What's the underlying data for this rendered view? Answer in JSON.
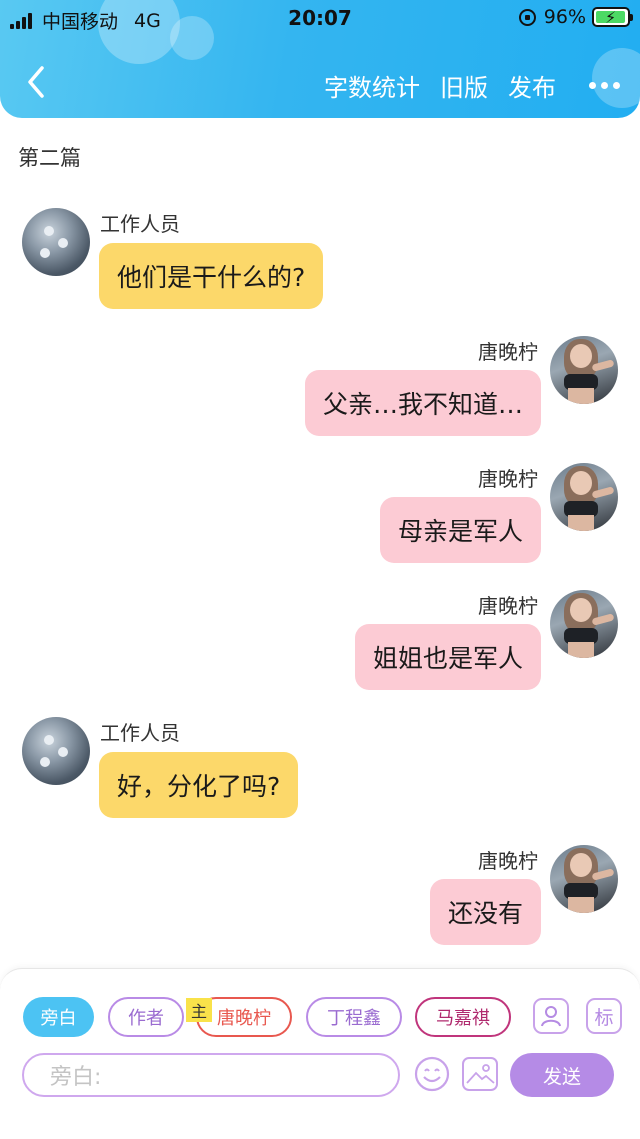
{
  "status_bar": {
    "carrier": "中国移动",
    "network": "4G",
    "time": "20:07",
    "battery": "96%",
    "battery_level": 0.96
  },
  "header": {
    "actions": [
      "字数统计",
      "旧版",
      "发布"
    ]
  },
  "section_title": "第二篇",
  "messages": [
    {
      "side": "left",
      "name": "工作人员",
      "text": "他们是干什么的?",
      "color": "#fcd86a"
    },
    {
      "side": "right",
      "name": "唐晚柠",
      "text": "父亲…我不知道…",
      "color": "#fccbd4"
    },
    {
      "side": "right",
      "name": "唐晚柠",
      "text": "母亲是军人",
      "color": "#fccbd4"
    },
    {
      "side": "right",
      "name": "唐晚柠",
      "text": "姐姐也是军人",
      "color": "#fccbd4"
    },
    {
      "side": "left",
      "name": "工作人员",
      "text": "好，分化了吗?",
      "color": "#fcd86a"
    },
    {
      "side": "right",
      "name": "唐晚柠",
      "text": "还没有",
      "color": "#fccbd4"
    }
  ],
  "composer": {
    "roles": [
      "旁白",
      "作者",
      "唐晚柠",
      "丁程鑫",
      "马嘉祺"
    ],
    "main_badge": "主",
    "mark_label": "标",
    "input_placeholder": "旁白:",
    "send_label": "发送"
  },
  "colors": {
    "header": "#34b5f0",
    "accent_purple": "#b58be6",
    "narrator_blue": "#4cc3f3"
  }
}
